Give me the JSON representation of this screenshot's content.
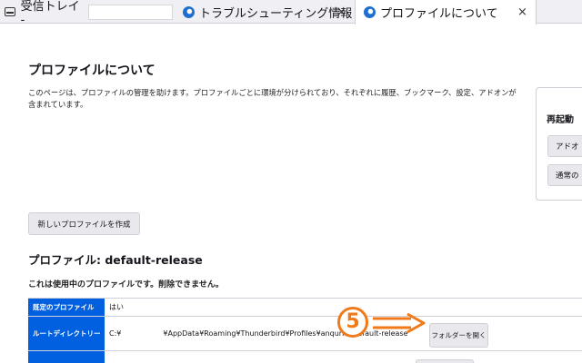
{
  "tabs": [
    {
      "title": "受信トレイ -",
      "icon": "mail-icon",
      "active": false
    },
    {
      "title": "トラブルシューティング情報",
      "icon": "thunderbird-icon",
      "close": "×",
      "active": false
    },
    {
      "title": "プロファイルについて",
      "icon": "thunderbird-icon",
      "close": "×",
      "active": true
    }
  ],
  "page": {
    "title": "プロファイルについて",
    "description": "このページは、プロファイルの管理を助けます。プロファイルごとに環境が分けられており、それぞれに履歴、ブックマーク、設定、アドオンが含まれています。"
  },
  "restart": {
    "title": "再起動",
    "addons_label": "アドオ",
    "normal_label": "通常の"
  },
  "create_profile_label": "新しいプロファイルを作成",
  "profile": {
    "heading": "プロファイル: default-release",
    "note": "これは使用中のプロファイルです。削除できません。",
    "rows": [
      {
        "key": "既定のプロファイル",
        "value": "はい"
      },
      {
        "key": "ルートディレクトリー",
        "value_prefix": "C:¥",
        "value_suffix": "¥AppData¥Roaming¥Thunderbird¥Profiles¥anqurkb.default-release",
        "button": "フォルダーを開く"
      }
    ]
  },
  "annotation": {
    "number": "5",
    "color": "#f07a1a"
  },
  "colors": {
    "accent": "#0060df",
    "tabstrip": "#f0f0f4"
  }
}
